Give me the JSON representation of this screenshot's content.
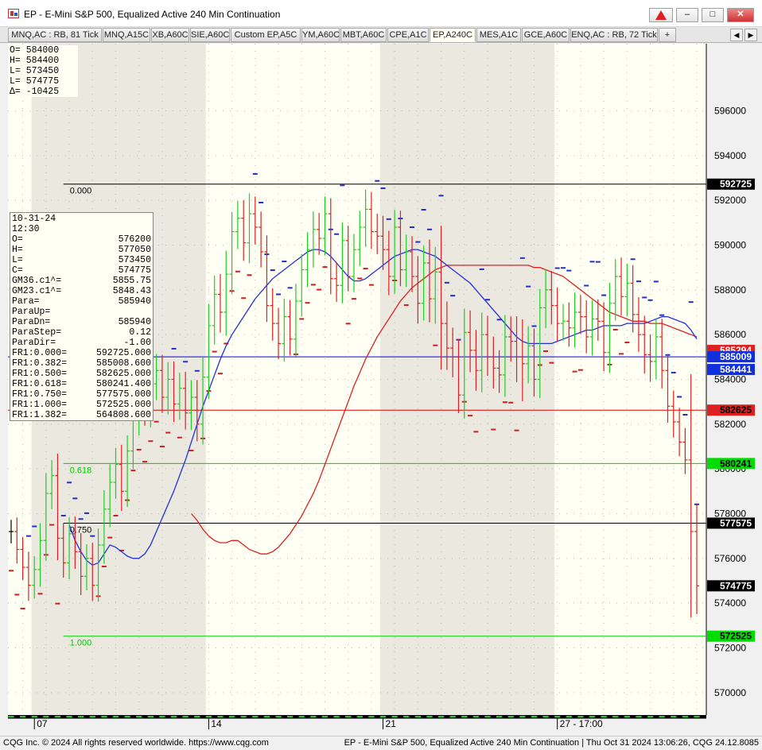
{
  "window": {
    "title": "EP - E-Mini S&P 500, Equalized Active 240 Min Continuation",
    "close_label": "✕",
    "min_label": "–",
    "max_label": "□"
  },
  "tabs": [
    {
      "label": "MNQ,AC : RB, 81 Tick",
      "active": false
    },
    {
      "label": "MNQ,A15C",
      "active": false
    },
    {
      "label": "XB,A60C",
      "active": false
    },
    {
      "label": "SIE,A60C",
      "active": false
    },
    {
      "label": "Custom EP,A5C",
      "active": false
    },
    {
      "label": "YM,A60C",
      "active": false
    },
    {
      "label": "MBT,A60C",
      "active": false
    },
    {
      "label": "CPE,A1C",
      "active": false
    },
    {
      "label": "EP,A240C",
      "active": true
    },
    {
      "label": "MES,A1C",
      "active": false
    },
    {
      "label": "GCE,A60C",
      "active": false
    },
    {
      "label": "ENQ,AC : RB, 72 Tick",
      "active": false
    },
    {
      "label": "+",
      "active": false
    }
  ],
  "tab_nav": {
    "prev": "◀",
    "next": "▶"
  },
  "ohlc_summary": [
    {
      "label": "O=",
      "value": "584000"
    },
    {
      "label": "H=",
      "value": "584400"
    },
    {
      "label": "L=",
      "value": "573450"
    },
    {
      "label": "L=",
      "value": "574775"
    },
    {
      "label": "Δ=",
      "value": "-10425"
    }
  ],
  "info_box": {
    "date": "10-31-24",
    "time": "12:30",
    "rows": [
      {
        "label": "O=",
        "value": "576200"
      },
      {
        "label": "H=",
        "value": "577050"
      },
      {
        "label": "L=",
        "value": "573450"
      },
      {
        "label": "C=",
        "value": "574775"
      },
      {
        "label": "GM36.c1^=",
        "value": "5855.75"
      },
      {
        "label": "GM23.c1^=",
        "value": "5848.43"
      },
      {
        "label": "Para=",
        "value": "585940"
      },
      {
        "label": "ParaUp=",
        "value": ""
      },
      {
        "label": "ParaDn=",
        "value": "585940"
      },
      {
        "label": "ParaStep=",
        "value": "0.12"
      },
      {
        "label": "ParaDir=",
        "value": "-1.00"
      },
      {
        "label": "FR1:0.000=",
        "value": "592725.000"
      },
      {
        "label": "FR1:0.382=",
        "value": "585008.600"
      },
      {
        "label": "FR1:0.500=",
        "value": "582625.000"
      },
      {
        "label": "FR1:0.618=",
        "value": "580241.400"
      },
      {
        "label": "FR1:0.750=",
        "value": "577575.000"
      },
      {
        "label": "FR1:1.000=",
        "value": "572525.000"
      },
      {
        "label": "FR1:1.382=",
        "value": "564808.600"
      }
    ]
  },
  "chart_data": {
    "type": "ohlc",
    "y_range": [
      569000,
      599000
    ],
    "y_ticks": [
      570000,
      572000,
      574000,
      576000,
      578000,
      580000,
      582000,
      584000,
      586000,
      588000,
      590000,
      592000,
      594000,
      596000
    ],
    "x_labels": [
      {
        "label": "07",
        "index": 4
      },
      {
        "label": "14",
        "index": 34
      },
      {
        "label": "21",
        "index": 64
      },
      {
        "label": "27 - 17:00",
        "index": 94
      }
    ],
    "shaded_sessions": [
      [
        3,
        33
      ],
      [
        63,
        93
      ]
    ],
    "bar_count": 119,
    "fib_levels": [
      {
        "ratio": "0.000",
        "price": 592725,
        "color": "#000000",
        "ratio_color": "#000000"
      },
      {
        "ratio": "0.382",
        "price": 585008.6,
        "color": "#0000ff",
        "ratio_color": ""
      },
      {
        "ratio": "0.500",
        "price": 582625,
        "color": "#dd0000",
        "ratio_color": ""
      },
      {
        "ratio": "0.618",
        "price": 580241.4,
        "color": "#00cc00",
        "ratio_color": "#00cc00"
      },
      {
        "ratio": "0.750",
        "price": 577575,
        "color": "#000000",
        "ratio_color": "#000000"
      },
      {
        "ratio": "1.000",
        "price": 572525,
        "color": "#00cc00",
        "ratio_color": "#00cc00"
      }
    ],
    "price_labels": [
      {
        "text": "592725",
        "price": 592725,
        "bg": "#000000",
        "fg": "#ffffff"
      },
      {
        "text": "585294",
        "price": 585294,
        "bg": "#dd2020",
        "fg": "#ffffff"
      },
      {
        "text": "585009",
        "price": 585009,
        "bg": "#1030e0",
        "fg": "#ffffff"
      },
      {
        "text": "584441",
        "price": 584441,
        "bg": "#1030e0",
        "fg": "#ffffff"
      },
      {
        "text": "582625",
        "price": 582625,
        "bg": "#dd2020",
        "fg": "#000000"
      },
      {
        "text": "580241",
        "price": 580241,
        "bg": "#00dd00",
        "fg": "#000000"
      },
      {
        "text": "577575",
        "price": 577575,
        "bg": "#000000",
        "fg": "#ffffff"
      },
      {
        "text": "574775",
        "price": 574775,
        "bg": "#000000",
        "fg": "#ffffff"
      },
      {
        "text": "572525",
        "price": 572525,
        "bg": "#00dd00",
        "fg": "#000000"
      }
    ],
    "closes": [
      577200,
      576400,
      575600,
      574800,
      575500,
      576800,
      578900,
      579700,
      576900,
      575800,
      577100,
      576300,
      575200,
      576000,
      574800,
      576600,
      578200,
      579400,
      580200,
      579000,
      580800,
      582400,
      583600,
      582700,
      583800,
      584400,
      583200,
      584000,
      582900,
      583600,
      582500,
      583200,
      582000,
      584100,
      586400,
      587800,
      587000,
      588700,
      590600,
      591200,
      590100,
      591400,
      590800,
      589700,
      587300,
      586500,
      585600,
      586800,
      585800,
      587500,
      588900,
      589800,
      590700,
      590300,
      591400,
      588500,
      588200,
      590200,
      588600,
      589800,
      590800,
      591600,
      590600,
      590400,
      589800,
      588600,
      590800,
      588900,
      589700,
      588600,
      587400,
      589200,
      587600,
      588800,
      586500,
      585400,
      585000,
      583300,
      586100,
      585300,
      584400,
      586000,
      585000,
      584500,
      584200,
      585900,
      585700,
      585000,
      584700,
      585500,
      584000,
      587200,
      588000,
      587300,
      586500,
      586600,
      586300,
      587000,
      586800,
      585900,
      586700,
      586600,
      585200,
      587400,
      588600,
      587700,
      588300,
      586900,
      586000,
      585100,
      584800,
      585900,
      584400,
      582800,
      582100,
      581200,
      580400,
      577200,
      574775
    ],
    "ranges": [
      1500,
      1800,
      1600,
      2000,
      1700,
      2200,
      2600,
      2000,
      2800,
      1900,
      2100,
      2200,
      2400,
      1800,
      2000,
      2100,
      2400,
      2300,
      2100,
      2500,
      2000,
      2300,
      2600,
      2200,
      2400,
      2100,
      2000,
      2200,
      2300,
      2000,
      2100,
      2200,
      2200,
      2600,
      2800,
      2400,
      2600,
      3000,
      2500,
      2200,
      2300,
      2600,
      2200,
      2000,
      2100,
      2200,
      2000,
      2300,
      2100,
      2200,
      2000,
      2200,
      2300,
      2100,
      2200,
      2000,
      2100,
      2300,
      1900,
      2000,
      2100,
      2500,
      2200,
      2300,
      2600,
      2400,
      2200,
      2100,
      2200,
      2000,
      2600,
      2200,
      3000,
      3200,
      5900,
      2800,
      2600,
      2300,
      3000,
      2800,
      2600,
      2800,
      2400,
      2600,
      2300,
      2800,
      2600,
      3200,
      4800,
      2500,
      2200,
      2400,
      2600,
      2400,
      2300,
      2200,
      2400,
      2500,
      2200,
      2100,
      2400,
      2500,
      2400,
      2600,
      2200,
      2400,
      2500,
      2300,
      2200,
      2400,
      2600,
      2300,
      2300,
      2100,
      2000,
      1800,
      1800,
      10950,
      3600
    ],
    "ma_blue": [
      577500,
      576800,
      576300,
      575900,
      575700,
      575800,
      576200,
      576600,
      576500,
      576300,
      576100,
      576000,
      576000,
      576200,
      576600,
      577200,
      577800,
      578400,
      579000,
      579700,
      580400,
      581200,
      582000,
      582800,
      583500,
      584200,
      584900,
      585500,
      586000,
      586400,
      586800,
      587200,
      587600,
      587900,
      588200,
      588500,
      588700,
      588900,
      589100,
      589300,
      589500,
      589700,
      589800,
      589800,
      589700,
      589500,
      589200,
      588900,
      588600,
      588400,
      588400,
      588500,
      588700,
      588900,
      589100,
      589300,
      589500,
      589600,
      589700,
      589800,
      589800,
      589700,
      589600,
      589500,
      589300,
      589100,
      588900,
      588700,
      588500,
      588300,
      588000,
      587700,
      587400,
      587100,
      586800,
      586500,
      586200,
      585900,
      585700,
      585600,
      585600,
      585600,
      585600,
      585600,
      585700,
      585800,
      585900,
      586000,
      586100,
      586200,
      586200,
      586300,
      586400,
      586400,
      586400,
      586400,
      586500,
      586500,
      586500,
      586500,
      586600,
      586700,
      586800,
      586800,
      586700,
      586600,
      586500,
      586200,
      585800
    ],
    "ma_red": [
      578000,
      577700,
      577300,
      577000,
      576800,
      576700,
      576700,
      576800,
      576800,
      576600,
      576400,
      576300,
      576200,
      576200,
      576300,
      576500,
      576800,
      577100,
      577500,
      577900,
      578400,
      578900,
      579500,
      580200,
      580900,
      581600,
      582300,
      583000,
      583700,
      584300,
      584900,
      585400,
      585900,
      586300,
      586700,
      587100,
      587500,
      587800,
      588100,
      588300,
      588500,
      588700,
      588900,
      589000,
      589100,
      589100,
      589100,
      589100,
      589100,
      589100,
      589100,
      589100,
      589100,
      589100,
      589100,
      589100,
      589100,
      589100,
      589100,
      589000,
      589000,
      588900,
      588800,
      588700,
      588600,
      588400,
      588200,
      588000,
      587800,
      587600,
      587400,
      587200,
      587000,
      586900,
      586800,
      586700,
      586600,
      586600,
      586600,
      586500,
      586500,
      586500,
      586400,
      586300,
      586200,
      586100,
      586000,
      585900
    ]
  },
  "status": {
    "left": "CQG Inc. © 2024 All rights reserved worldwide. https://www.cqg.com",
    "right": "EP - E-Mini S&P 500, Equalized Active 240 Min Continuation | Thu Oct 31 2024 13:06:26, CQG 24.12.8085"
  }
}
